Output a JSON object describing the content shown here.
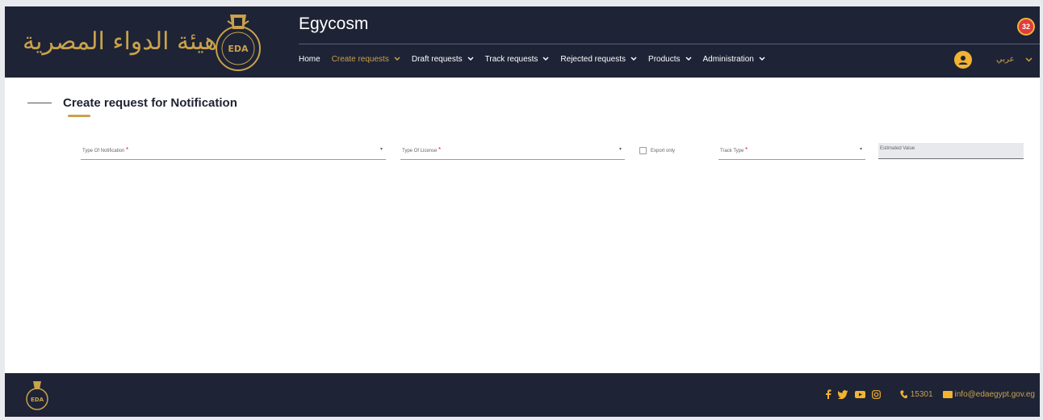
{
  "header": {
    "logo_arabic_text": "هيئة الدواء المصرية",
    "seal_text": "EDA",
    "seal_ring_text": "EGYPTIAN DRUG AUTHORITY",
    "app_title": "Egycosm",
    "notification_count": "32",
    "language_label": "عربي"
  },
  "nav": {
    "items": [
      {
        "label": "Home",
        "dropdown": false,
        "active": false
      },
      {
        "label": "Create requests",
        "dropdown": true,
        "active": true
      },
      {
        "label": "Draft requests",
        "dropdown": true,
        "active": false
      },
      {
        "label": "Track requests",
        "dropdown": true,
        "active": false
      },
      {
        "label": "Rejected requests",
        "dropdown": true,
        "active": false
      },
      {
        "label": "Products",
        "dropdown": true,
        "active": false
      },
      {
        "label": "Administration",
        "dropdown": true,
        "active": false
      }
    ]
  },
  "page": {
    "title": "Create request for Notification"
  },
  "form": {
    "type_of_notification_label": "Type Of Notification",
    "type_of_license_label": "Type Of License",
    "export_only_label": "Export only",
    "track_type_label": "Track Type",
    "estimated_value_label": "Estimated Value",
    "required_mark": "*",
    "dropdown_arrow": "▾"
  },
  "footer": {
    "logo_text": "EDA",
    "phone": "15301",
    "email": "info@edaegypt.gov.eg"
  },
  "colors": {
    "header_bg": "#1e2336",
    "accent_gold": "#c9a24a",
    "badge_red": "#e23b3b",
    "avatar_yellow": "#f2b330"
  }
}
